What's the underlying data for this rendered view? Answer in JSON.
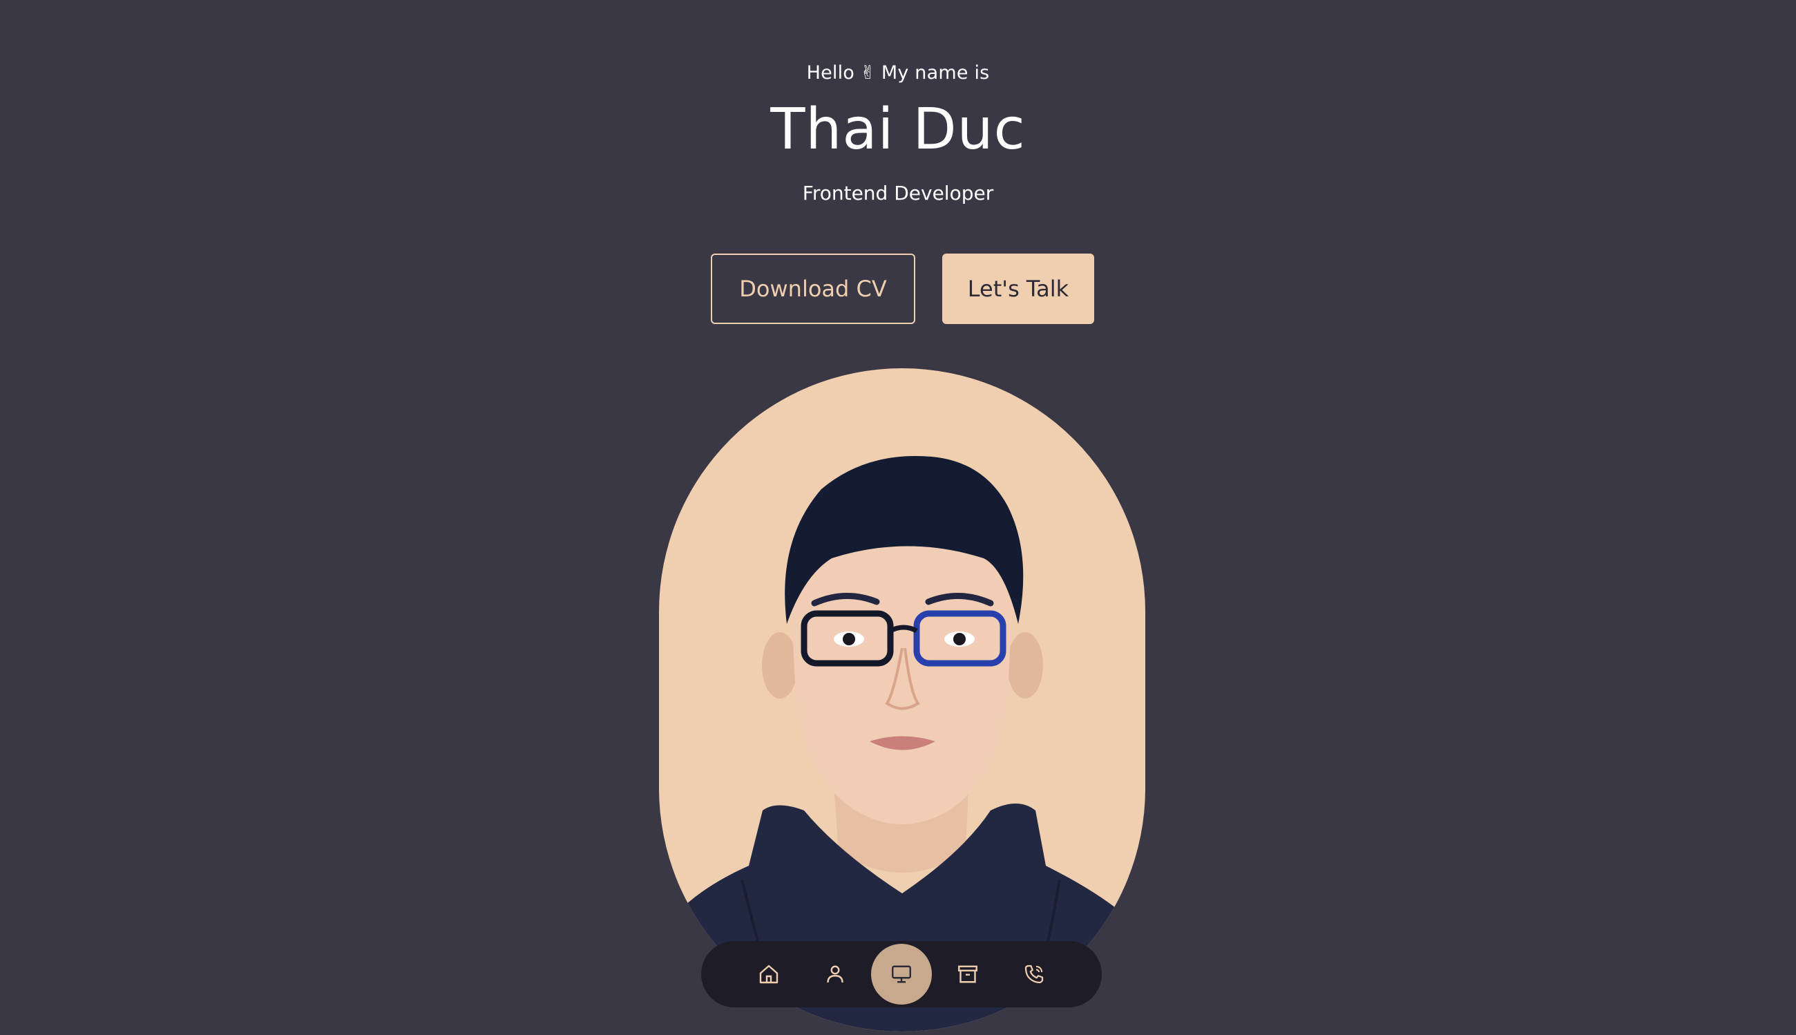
{
  "hero": {
    "greeting_before": "Hello",
    "greeting_emoji": "✌",
    "greeting_after": "My name is",
    "name": "Thai Duc",
    "role": "Frontend Developer"
  },
  "actions": {
    "download_label": "Download CV",
    "talk_label": "Let's Talk"
  },
  "nav": {
    "items": [
      {
        "icon": "home-icon",
        "active": false
      },
      {
        "icon": "user-icon",
        "active": false
      },
      {
        "icon": "monitor-icon",
        "active": true
      },
      {
        "icon": "archive-icon",
        "active": false
      },
      {
        "icon": "phone-icon",
        "active": false
      }
    ]
  },
  "colors": {
    "background": "#3a3845",
    "accent": "#f0cfb0",
    "nav_background": "#1e1d27",
    "nav_active": "#c7a98d"
  }
}
